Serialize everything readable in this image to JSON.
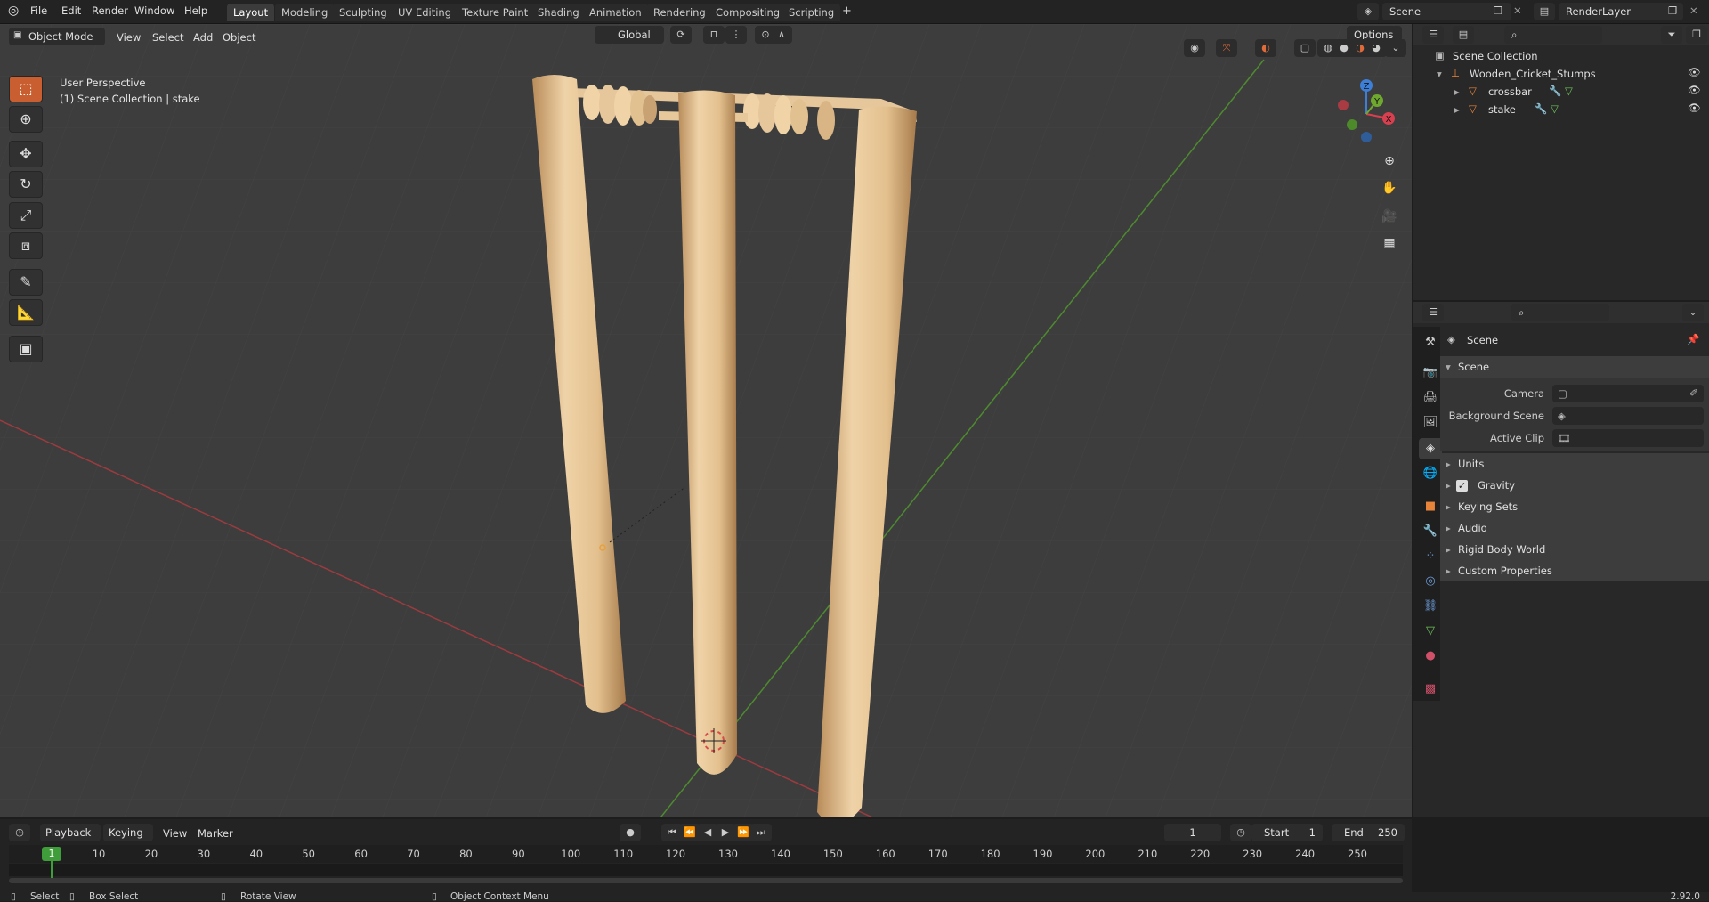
{
  "topbar": {
    "menus": [
      "File",
      "Edit",
      "Render",
      "Window",
      "Help"
    ],
    "workspace_tabs": [
      "Layout",
      "Modeling",
      "Sculpting",
      "UV Editing",
      "Texture Paint",
      "Shading",
      "Animation",
      "Rendering",
      "Compositing",
      "Scripting"
    ],
    "active_tab": "Layout",
    "add_tab": "+",
    "scene_name": "Scene",
    "view_layer": "RenderLayer"
  },
  "viewport": {
    "mode": "Object Mode",
    "menus": [
      "View",
      "Select",
      "Add",
      "Object"
    ],
    "orientation": "Global",
    "options_label": "Options",
    "overlay_title": "User Perspective",
    "overlay_subtitle": "(1) Scene Collection | stake",
    "gizmo_axes": [
      "X",
      "Y",
      "Z"
    ],
    "tools": [
      "select-box",
      "cursor",
      "move",
      "rotate",
      "scale",
      "transform",
      "annotate",
      "measure",
      "add-cube"
    ],
    "active_tool": "select-box"
  },
  "outliner": {
    "root": "Scene Collection",
    "collection": "Wooden_Cricket_Stumps",
    "objects": [
      "crossbar",
      "stake"
    ]
  },
  "properties": {
    "context": "Scene",
    "panel_title": "Scene",
    "fields": [
      {
        "label": "Camera",
        "value": ""
      },
      {
        "label": "Background Scene",
        "value": ""
      },
      {
        "label": "Active Clip",
        "value": ""
      }
    ],
    "subpanels": [
      "Units",
      "Gravity",
      "Keying Sets",
      "Audio",
      "Rigid Body World",
      "Custom Properties"
    ],
    "gravity_enabled": true
  },
  "timeline": {
    "menus": [
      "Playback",
      "Keying",
      "View",
      "Marker"
    ],
    "current_frame": "1",
    "start_label": "Start",
    "start": "1",
    "end_label": "End",
    "end": "250",
    "ruler": [
      "1",
      "10",
      "20",
      "30",
      "40",
      "50",
      "60",
      "70",
      "80",
      "90",
      "100",
      "110",
      "120",
      "130",
      "140",
      "150",
      "160",
      "170",
      "180",
      "190",
      "200",
      "210",
      "220",
      "230",
      "240",
      "250"
    ]
  },
  "statusbar": {
    "hints": [
      "Select",
      "Box Select",
      "Rotate View",
      "Object Context Menu"
    ],
    "version": "2.92.0"
  },
  "colors": {
    "accent": "#c95f30",
    "x_axis": "#d9404f",
    "y_axis": "#6ea82f",
    "z_axis": "#3d7fd6",
    "wood": "#e6c79b",
    "frame_marker": "#3f9e3a"
  }
}
